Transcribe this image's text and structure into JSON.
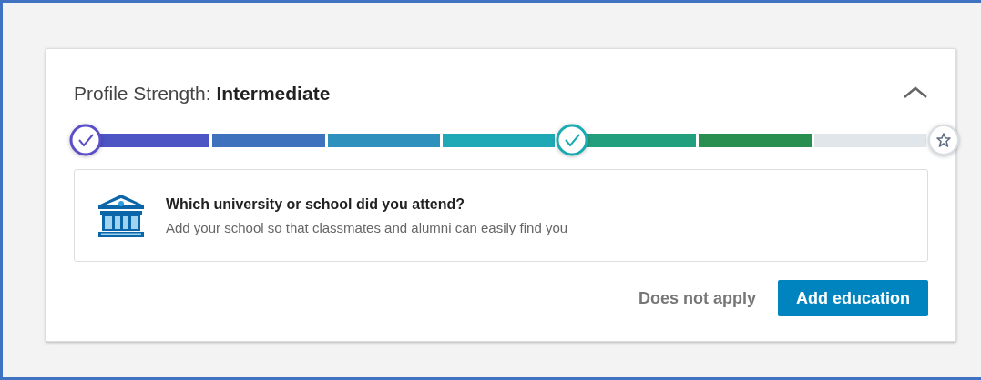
{
  "card": {
    "title": "Profile Strength:",
    "level_name": "Intermediate",
    "expanded": true,
    "track": [
      {
        "kind": "milestone",
        "reached": true,
        "color": "#5a4fc8"
      },
      {
        "kind": "segment",
        "filled": true,
        "color": "#4d55c4"
      },
      {
        "kind": "segment",
        "filled": true,
        "color": "#3e72bd"
      },
      {
        "kind": "segment",
        "filled": true,
        "color": "#2e90bd"
      },
      {
        "kind": "segment",
        "filled": true,
        "color": "#1fa9b6"
      },
      {
        "kind": "milestone",
        "reached": true,
        "color": "#1aabb0"
      },
      {
        "kind": "segment",
        "filled": true,
        "color": "#22a07e"
      },
      {
        "kind": "segment",
        "filled": true,
        "color": "#288f50"
      },
      {
        "kind": "segment",
        "filled": false
      },
      {
        "kind": "goal",
        "reached": false,
        "color": "#d9dee3"
      }
    ],
    "prompt": {
      "question": "Which university or school did you attend?",
      "hint": "Add your school so that classmates and alumni can easily find you"
    },
    "buttons": [
      {
        "label": "Does not apply",
        "kind": "secondary"
      },
      {
        "label": "Add education",
        "kind": "primary"
      }
    ]
  }
}
